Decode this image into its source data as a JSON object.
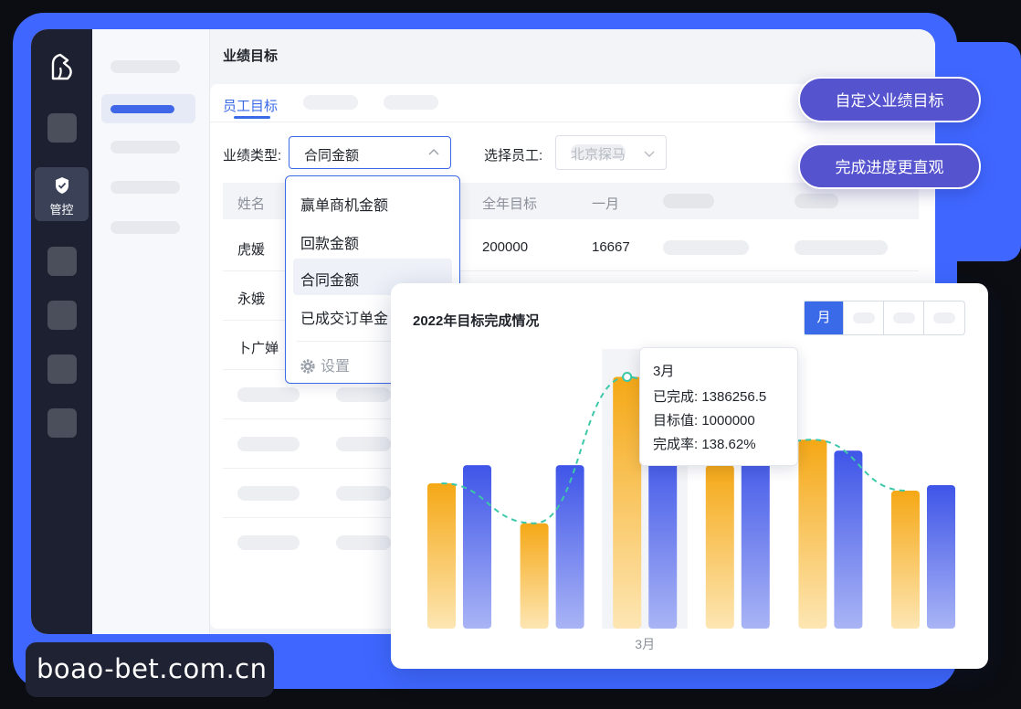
{
  "sidebar": {
    "active_label": "管控",
    "logo": "horse-logo"
  },
  "page": {
    "title": "业绩目标"
  },
  "tabs": {
    "active": "员工目标"
  },
  "filters": {
    "type_label": "业绩类型:",
    "type_value": "合同金额",
    "employee_label": "选择员工:",
    "employee_placeholder": "北京探马"
  },
  "table": {
    "headers": [
      "姓名",
      "全年目标",
      "一月"
    ],
    "rows": [
      {
        "name": "虎媛",
        "annual": "200000",
        "jan": "16667"
      },
      {
        "name": "永娥"
      },
      {
        "name": "卜广婵"
      }
    ]
  },
  "dropdown": {
    "items": [
      "赢单商机金额",
      "回款金额",
      "合同金额",
      "已成交订单金"
    ],
    "selected": "合同金额",
    "settings": "设置"
  },
  "buttons": {
    "custom_goal": "自定义业绩目标",
    "progress": "完成进度更直观"
  },
  "chart_panel": {
    "title": "2022年目标完成情况",
    "segment_active": "月",
    "tooltip": {
      "title": "3月",
      "completed": "已完成: 1386256.5",
      "target": "目标值: 1000000",
      "rate": "完成率: 138.62%"
    }
  },
  "chart_data": {
    "type": "bar",
    "categories": [
      "",
      "",
      "3月",
      "",
      "",
      ""
    ],
    "series": [
      {
        "values": [
          800000,
          580000,
          1386256.5,
          900000,
          1040000,
          760000
        ],
        "color": "#f5a623"
      },
      {
        "values": [
          900000,
          900000,
          1000000,
          1000000,
          980000,
          790000
        ],
        "color": "#4154e8"
      }
    ],
    "line": {
      "values": [
        800000,
        580000,
        1386256.5,
        900000,
        1040000,
        760000
      ],
      "style": "dashed",
      "color": "#3cc8a8"
    },
    "ylim": [
      0,
      1600000
    ],
    "grid": false
  },
  "watermark": "boao-bet.com.cn"
}
